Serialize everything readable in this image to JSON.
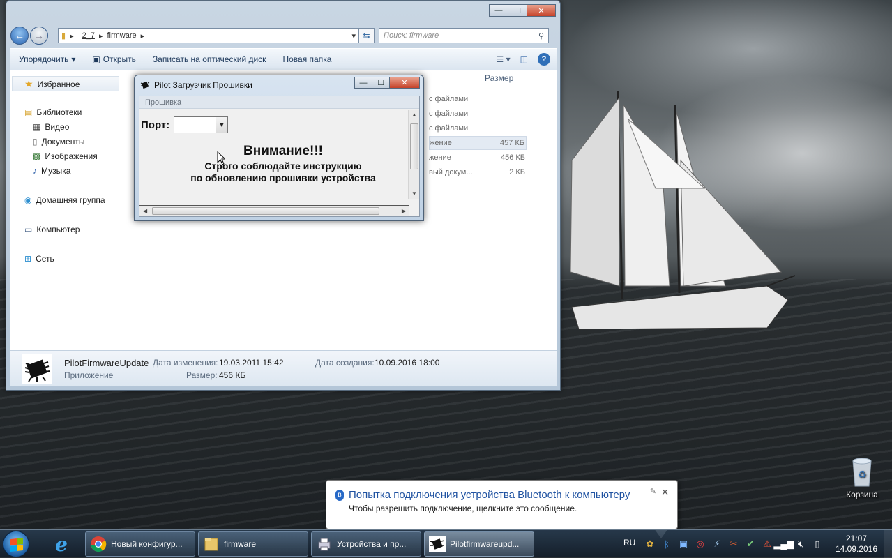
{
  "explorer": {
    "caption": {
      "minimize": "—",
      "maximize": "☐",
      "close": "✕"
    },
    "nav": {
      "back": "←",
      "forward": "→"
    },
    "breadcrumb": [
      "2_7",
      "firmware"
    ],
    "search_placeholder": "Поиск: firmware",
    "toolbar": {
      "organize": "Упорядочить",
      "open": "Открыть",
      "burn": "Записать на оптический диск",
      "new_folder": "Новая папка"
    },
    "navpane": {
      "favorites": "Избранное",
      "libraries": "Библиотеки",
      "video": "Видео",
      "documents": "Документы",
      "images": "Изображения",
      "music": "Музыка",
      "homegroup": "Домашняя группа",
      "computer": "Компьютер",
      "network": "Сеть"
    },
    "columns": {
      "size": "Размер"
    },
    "files": [
      {
        "name": "с файлами",
        "size": ""
      },
      {
        "name": "с файлами",
        "size": ""
      },
      {
        "name": "с файлами",
        "size": ""
      },
      {
        "name": "жение",
        "size": "457 КБ"
      },
      {
        "name": "жение",
        "size": "456 КБ"
      },
      {
        "name": "вый докум...",
        "size": "2 КБ"
      }
    ],
    "details": {
      "name": "PilotFirmwareUpdate",
      "type": "Приложение",
      "modified_label": "Дата изменения:",
      "modified": "19.03.2011 15:42",
      "created_label": "Дата создания:",
      "created": "10.09.2016 18:00",
      "size_label": "Размер:",
      "size": "456 КБ"
    }
  },
  "pilot": {
    "title": "Pilot Загрузчик Прошивки",
    "caption": {
      "minimize": "—",
      "maximize": "☐",
      "close": "✕"
    },
    "menu": "Прошивка",
    "port_label": "Порт:",
    "port_value": "",
    "warning_title": "Внимание!!!",
    "warning_line1": "Строго соблюдайте  инструкцию",
    "warning_line2": "по обновлению прошивки устройства"
  },
  "desktop": {
    "recycle_bin": "Корзина"
  },
  "balloon": {
    "title": "Попытка подключения устройства Bluetooth к компьютеру",
    "text": "Чтобы разрешить подключение, щелкните это сообщение.",
    "close": "✕"
  },
  "taskbar": {
    "tasks": [
      {
        "label": "Новый конфигур..."
      },
      {
        "label": "firmware"
      },
      {
        "label": "Устройства и пр..."
      },
      {
        "label": "Pilotfirmwareupd..."
      }
    ],
    "lang": "RU",
    "time": "21:07",
    "date": "14.09.2016"
  },
  "colors": {
    "accent": "#1f52a1",
    "close_button": "#c6442b"
  }
}
